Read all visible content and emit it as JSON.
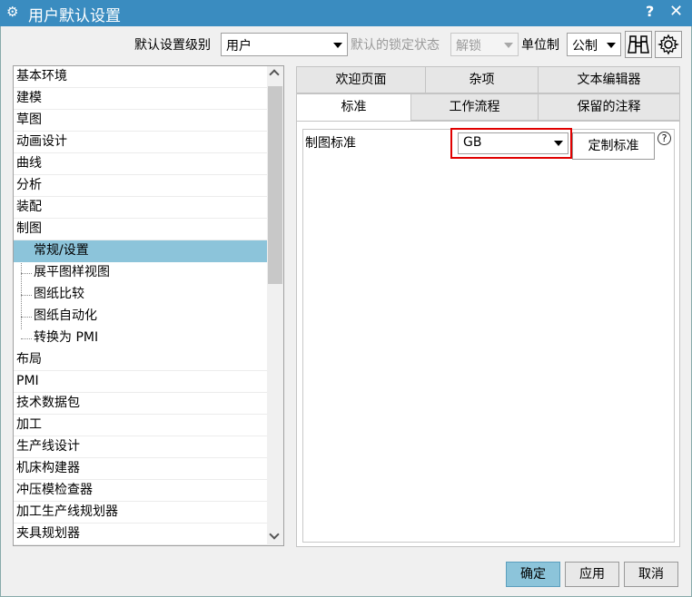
{
  "window": {
    "title": "用户默认设置",
    "help_glyph": "?",
    "close_glyph": "✕"
  },
  "toolbar": {
    "level_label": "默认设置级别",
    "level_value": "用户",
    "lock_label": "默认的锁定状态",
    "lock_value": "解锁",
    "unit_label": "单位制",
    "unit_value": "公制"
  },
  "tree": {
    "items": [
      {
        "label": "基本环境"
      },
      {
        "label": "建模"
      },
      {
        "label": "草图"
      },
      {
        "label": "动画设计"
      },
      {
        "label": "曲线"
      },
      {
        "label": "分析"
      },
      {
        "label": "装配"
      },
      {
        "label": "制图"
      },
      {
        "label": "常规/设置"
      },
      {
        "label": "展平图样视图"
      },
      {
        "label": "图纸比较"
      },
      {
        "label": "图纸自动化"
      },
      {
        "label": "转换为 PMI"
      },
      {
        "label": "布局"
      },
      {
        "label": "PMI"
      },
      {
        "label": "技术数据包"
      },
      {
        "label": "加工"
      },
      {
        "label": "生产线设计"
      },
      {
        "label": "机床构建器"
      },
      {
        "label": "冲压模检查器"
      },
      {
        "label": "加工生产线规划器"
      },
      {
        "label": "夹具规划器"
      }
    ]
  },
  "tabs": {
    "row1": [
      "欢迎页面",
      "杂项",
      "文本编辑器"
    ],
    "row2": [
      "标准",
      "工作流程",
      "保留的注释"
    ]
  },
  "panel": {
    "standard_label": "制图标准",
    "standard_value": "GB",
    "customize_button": "定制标准",
    "help_glyph": "?"
  },
  "footer": {
    "ok": "确定",
    "apply": "应用",
    "cancel": "取消"
  }
}
